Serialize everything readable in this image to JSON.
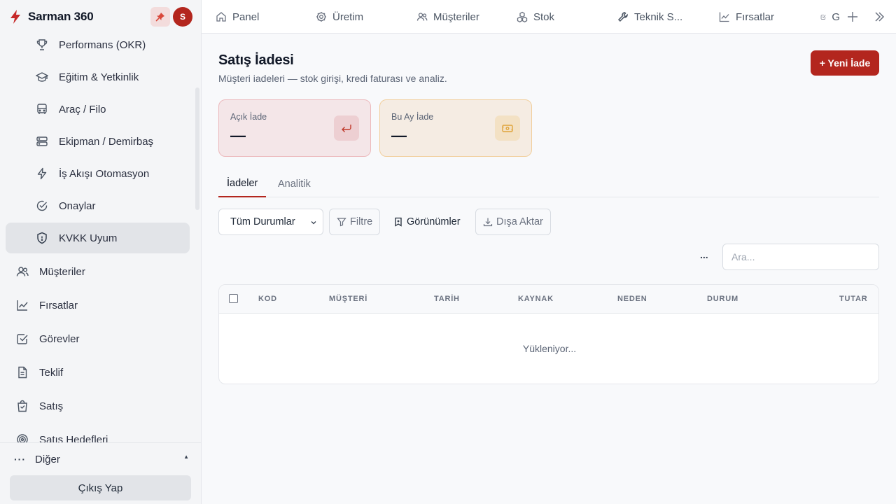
{
  "brand": {
    "title": "Sarman 360",
    "avatar_initial": "S",
    "accent": "#b3261e"
  },
  "sidebar": {
    "sub_items": [
      {
        "label": "Performans (OKR)",
        "icon": "trophy-icon"
      },
      {
        "label": "Eğitim & Yetkinlik",
        "icon": "graduation-cap-icon"
      },
      {
        "label": "Araç / Filo",
        "icon": "bus-icon"
      },
      {
        "label": "Ekipman / Demirbaş",
        "icon": "server-icon"
      },
      {
        "label": "İş Akışı Otomasyon",
        "icon": "bolt-icon"
      },
      {
        "label": "Onaylar",
        "icon": "check-circle-icon"
      },
      {
        "label": "KVKK Uyum",
        "icon": "shield-icon",
        "active": true
      }
    ],
    "main_items": [
      {
        "label": "Müşteriler",
        "icon": "users-icon"
      },
      {
        "label": "Fırsatlar",
        "icon": "trend-icon"
      },
      {
        "label": "Görevler",
        "icon": "checkbox-icon"
      },
      {
        "label": "Teklif",
        "icon": "document-icon"
      },
      {
        "label": "Satış",
        "icon": "shopping-bag-icon"
      },
      {
        "label": "Satış Hedefleri",
        "icon": "target-icon"
      }
    ],
    "more_label": "Diğer",
    "logout_label": "Çıkış Yap"
  },
  "topbar": {
    "tabs": [
      {
        "label": "Panel",
        "icon": "home-icon"
      },
      {
        "label": "Üretim",
        "icon": "gear-icon"
      },
      {
        "label": "Müşteriler",
        "icon": "users-icon"
      },
      {
        "label": "Stok",
        "icon": "boxes-icon"
      },
      {
        "label": "Teknik S...",
        "icon": "wrench-icon"
      },
      {
        "label": "Fırsatlar",
        "icon": "trend-icon"
      },
      {
        "label": "G",
        "icon": "checkbox-icon"
      }
    ]
  },
  "page": {
    "title": "Satış İadesi",
    "subtitle": "Müşteri iadeleri — stok girişi, kredi faturası ve analiz.",
    "new_button": "+ Yeni İade"
  },
  "kpis": [
    {
      "label": "Açık İade",
      "value": "—",
      "icon": "return-arrow-icon",
      "color": "#c0392b"
    },
    {
      "label": "Bu Ay İade",
      "value": "—",
      "icon": "banknote-icon",
      "color": "#e0a43a"
    }
  ],
  "tabs": {
    "returns": "İadeler",
    "analytics": "Analitik"
  },
  "toolbar": {
    "status_select": "Tüm Durumlar",
    "filter": "Filtre",
    "views": "Görünümler",
    "export": "Dışa Aktar",
    "more": "...",
    "search_placeholder": "Ara..."
  },
  "table": {
    "columns": [
      "KOD",
      "MÜŞTERİ",
      "TARİH",
      "KAYNAK",
      "NEDEN",
      "DURUM",
      "TUTAR"
    ],
    "loading_text": "Yükleniyor..."
  }
}
